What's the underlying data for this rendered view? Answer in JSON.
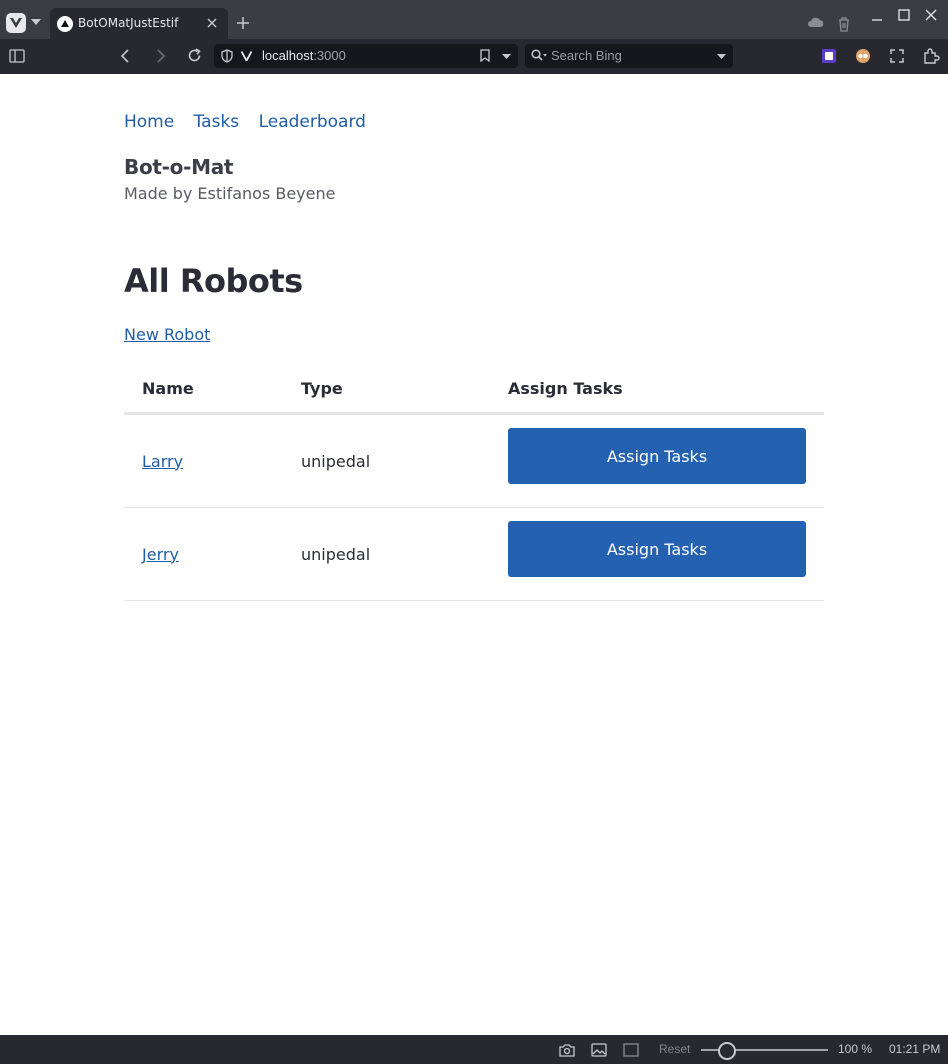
{
  "browser": {
    "tab_title": "BotOMatJustEstif",
    "address_host": "localhost",
    "address_port": ":3000",
    "search_placeholder": "Search Bing"
  },
  "nav": {
    "home": "Home",
    "tasks": "Tasks",
    "leaderboard": "Leaderboard"
  },
  "site": {
    "title": "Bot-o-Mat",
    "subtitle": "Made by Estifanos Beyene"
  },
  "page": {
    "heading": "All Robots",
    "new_robot_link": "New Robot"
  },
  "table": {
    "headers": [
      "Name",
      "Type",
      "Assign Tasks"
    ],
    "rows": [
      {
        "name": "Larry",
        "type": "unipedal",
        "action": "Assign Tasks"
      },
      {
        "name": "Jerry",
        "type": "unipedal",
        "action": "Assign Tasks"
      }
    ]
  },
  "statusbar": {
    "reset_label": "Reset",
    "zoom": "100 %",
    "time": "01:21 PM"
  },
  "colors": {
    "link": "#1f5ea6",
    "button": "#2462b1",
    "chrome_dark": "#272830"
  }
}
